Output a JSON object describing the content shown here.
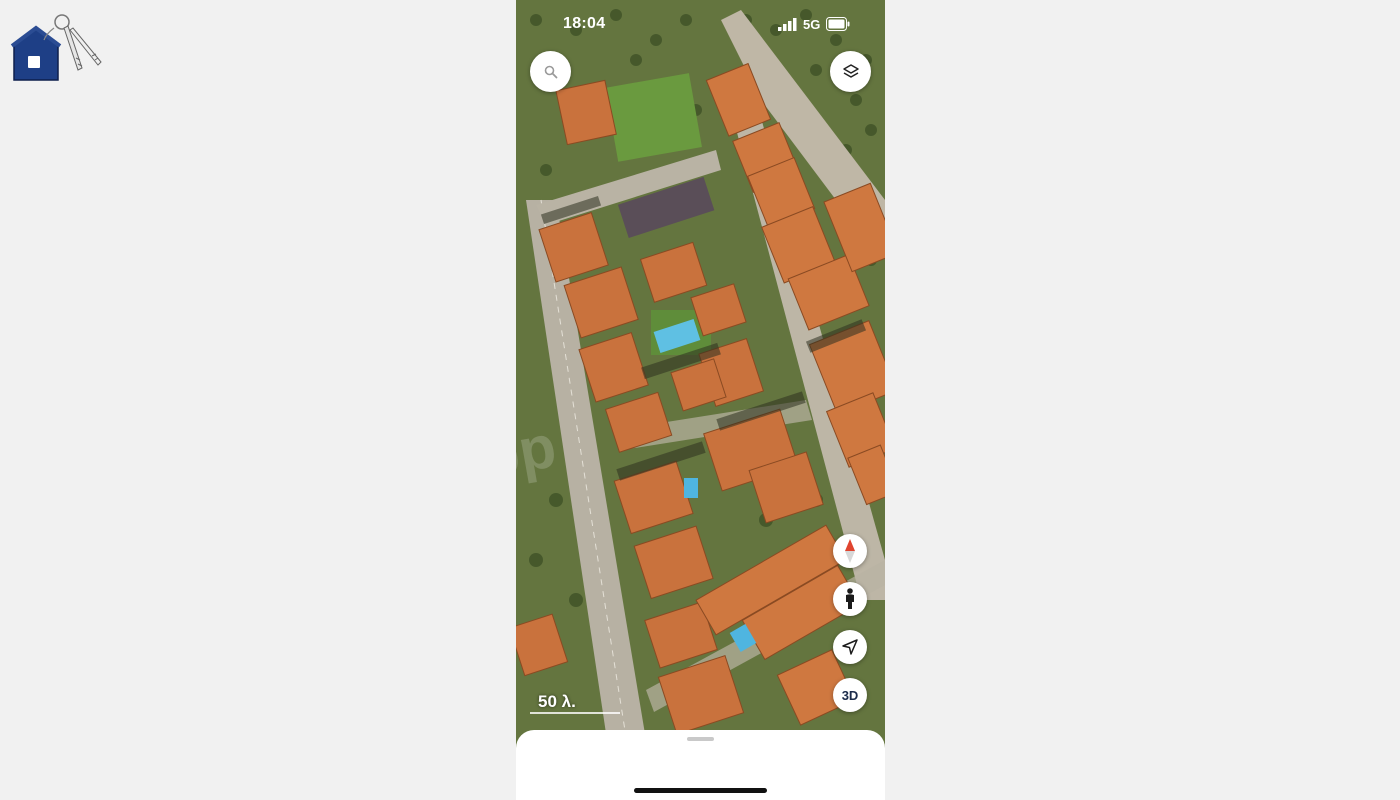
{
  "status_bar": {
    "time": "18:04",
    "network": "5G",
    "battery_icon": "battery-icon",
    "signal_icon": "signal-icon"
  },
  "controls": {
    "search_icon": "magnifier-icon",
    "layers_icon": "layers-icon",
    "compass_icon": "compass-icon",
    "street_view_icon": "person-icon",
    "locate_icon": "navigation-arrow-icon",
    "threed_label": "3D"
  },
  "scale": {
    "label": "50 λ."
  },
  "colors": {
    "roof": "#c8703a",
    "vegetation": "#5b6f3a",
    "road": "#b9b4a8",
    "accent_red": "#e0442f",
    "navy": "#1b2b4a"
  }
}
